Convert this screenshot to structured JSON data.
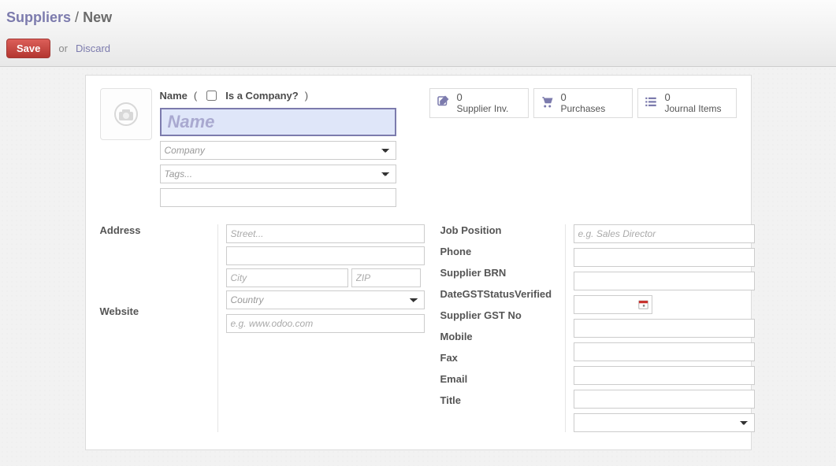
{
  "breadcrumb": {
    "parent": "Suppliers",
    "sep": "/",
    "current": "New"
  },
  "actions": {
    "save": "Save",
    "or": "or",
    "discard": "Discard"
  },
  "nameRow": {
    "label": "Name",
    "isCompanyLabel": "Is a Company?",
    "namePlaceholder": "Name",
    "companyPlaceholder": "Company",
    "tagsPlaceholder": "Tags..."
  },
  "stats": {
    "supplierInv": {
      "count": "0",
      "label": "Supplier Inv."
    },
    "purchases": {
      "count": "0",
      "label": "Purchases"
    },
    "journal": {
      "count": "0",
      "label": "Journal Items"
    }
  },
  "left": {
    "addressLabel": "Address",
    "websiteLabel": "Website",
    "streetPh": "Street...",
    "cityPh": "City",
    "zipPh": "ZIP",
    "countryPh": "Country",
    "websitePh": "e.g. www.odoo.com"
  },
  "right": {
    "jobPosition": "Job Position",
    "phone": "Phone",
    "brn": "Supplier BRN",
    "dateGst": "DateGSTStatusVerified",
    "gstNo": "Supplier GST No",
    "mobile": "Mobile",
    "fax": "Fax",
    "email": "Email",
    "title": "Title",
    "jobPh": "e.g. Sales Director"
  }
}
